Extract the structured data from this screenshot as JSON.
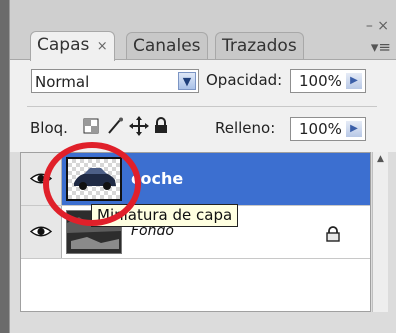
{
  "panel": {
    "tabs": [
      {
        "label": "Capas",
        "close": "×"
      },
      {
        "label": "Canales"
      },
      {
        "label": "Trazados"
      }
    ],
    "window_controls": "– ×",
    "menu_icon": "▾≡"
  },
  "options": {
    "blend_mode": "Normal",
    "opacity_label": "Opacidad:",
    "opacity_value": "100%",
    "lock_label": "Bloq.",
    "fill_label": "Relleno:",
    "fill_value": "100%"
  },
  "layers": [
    {
      "name": "coche",
      "selected": true
    },
    {
      "name": "Fondo",
      "locked": true
    }
  ],
  "tooltip": {
    "text": "Miniatura de capa"
  },
  "colors": {
    "selection": "#3c6fd0",
    "highlight": "#e0202a",
    "tooltip_bg": "#ffffe1"
  },
  "icons": [
    "eye-icon",
    "lock-icon",
    "brush-icon",
    "move-icon",
    "transparency-lock-icon",
    "chevron-down-icon",
    "arrow-right-icon",
    "scroll-up-icon",
    "panel-menu-icon"
  ]
}
